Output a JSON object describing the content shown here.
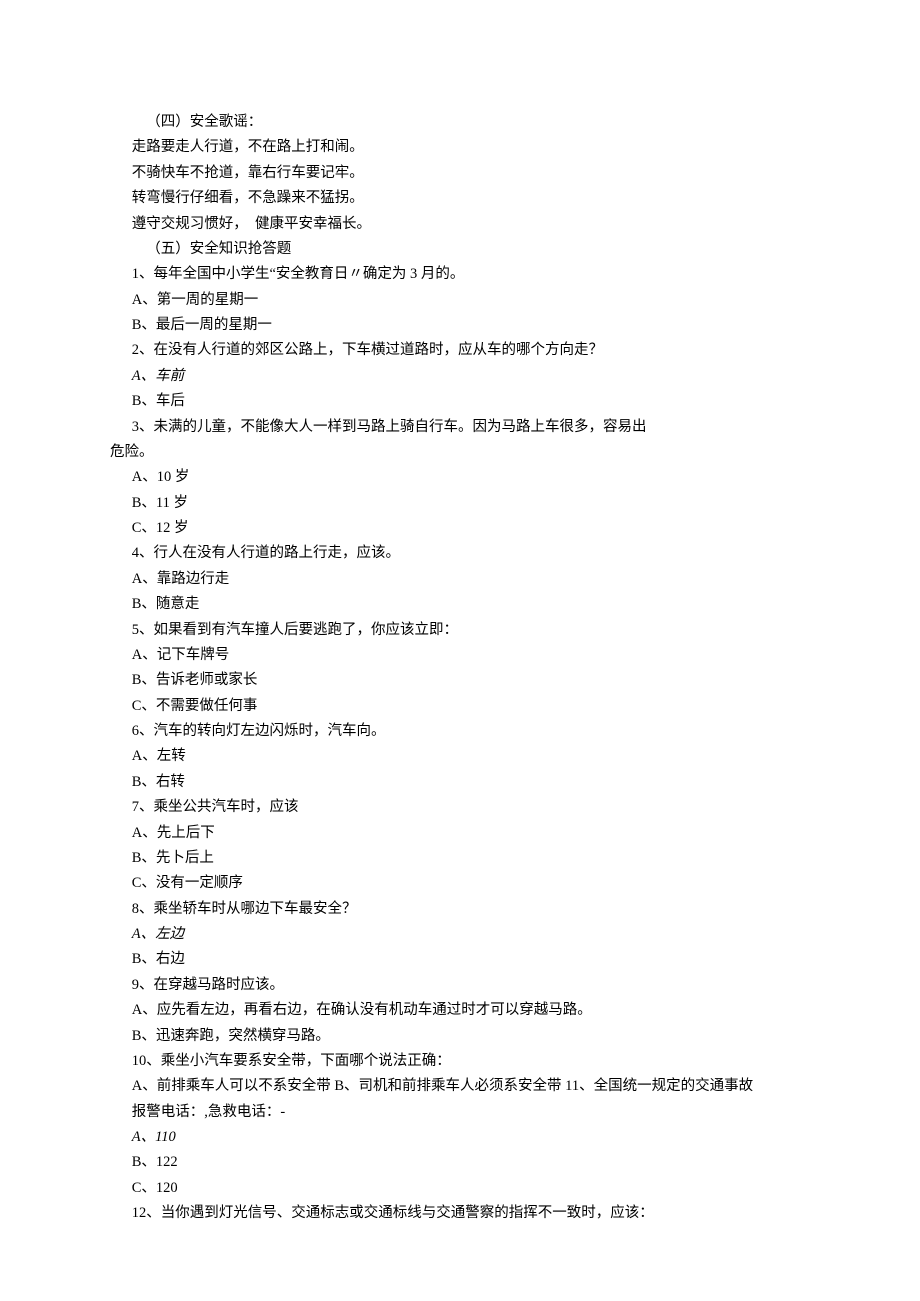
{
  "lines": [
    {
      "cls": "indent2",
      "text": "（四）安全歌谣："
    },
    {
      "cls": "indent1",
      "text": "走路要走人行道，不在路上打和闹。"
    },
    {
      "cls": "indent1",
      "text": "不骑快车不抢道，靠右行车要记牢。"
    },
    {
      "cls": "indent1",
      "text": "转弯慢行仔细看，不急躁来不猛拐。"
    },
    {
      "cls": "indent1",
      "text": "遵守交规习惯好，  健康平安幸福长。"
    },
    {
      "cls": "indent2",
      "text": "（五）安全知识抢答题"
    },
    {
      "cls": "indent1",
      "text": "1、每年全国中小学生“安全教育日〃确定为 3 月的。"
    },
    {
      "cls": "indent1",
      "text": "A、第一周的星期一"
    },
    {
      "cls": "indent1",
      "text": "B、最后一周的星期一"
    },
    {
      "cls": "indent1",
      "text": "2、在没有人行道的郊区公路上，下车横过道路时，应从车的哪个方向走？"
    },
    {
      "cls": "indent1 italic",
      "text": "A、车前"
    },
    {
      "cls": "indent1",
      "text": "B、车后"
    },
    {
      "cls": "indent1",
      "text": "3、未满的儿童，不能像大人一样到马路上骑自行车。因为马路上车很多，容易出"
    },
    {
      "cls": "noindent",
      "text": "危险。"
    },
    {
      "cls": "indent1",
      "text": "A、10 岁"
    },
    {
      "cls": "indent1",
      "text": "B、11 岁"
    },
    {
      "cls": "indent1",
      "text": "C、12 岁"
    },
    {
      "cls": "indent1",
      "text": "4、行人在没有人行道的路上行走，应该。"
    },
    {
      "cls": "indent1",
      "text": "A、靠路边行走"
    },
    {
      "cls": "indent1",
      "text": "B、随意走"
    },
    {
      "cls": "indent1",
      "text": "5、如果看到有汽车撞人后要逃跑了，你应该立即："
    },
    {
      "cls": "indent1",
      "text": "A、记下车牌号"
    },
    {
      "cls": "indent1",
      "text": "B、告诉老师或家长"
    },
    {
      "cls": "indent1",
      "text": "C、不需要做任何事"
    },
    {
      "cls": "indent1",
      "text": "6、汽车的转向灯左边闪烁时，汽车向。"
    },
    {
      "cls": "indent1",
      "text": "A、左转"
    },
    {
      "cls": "indent1",
      "text": "B、右转"
    },
    {
      "cls": "indent1",
      "text": "7、乘坐公共汽车时，应该"
    },
    {
      "cls": "indent1",
      "text": "A、先上后下"
    },
    {
      "cls": "indent1",
      "text": "B、先卜后上"
    },
    {
      "cls": "indent1",
      "text": "C、没有一定顺序"
    },
    {
      "cls": "indent1",
      "text": "8、乘坐轿车时从哪边下车最安全？"
    },
    {
      "cls": "indent1 italic",
      "text": "A、左边"
    },
    {
      "cls": "indent1",
      "text": "B、右边"
    },
    {
      "cls": "indent1",
      "text": "9、在穿越马路时应该。"
    },
    {
      "cls": "indent1",
      "text": "A、应先看左边，再看右边，在确认没有机动车通过时才可以穿越马路。"
    },
    {
      "cls": "indent1",
      "text": "B、迅速奔跑，突然横穿马路。"
    },
    {
      "cls": "indent1",
      "text": "10、乘坐小汽车要系安全带，下面哪个说法正确："
    },
    {
      "cls": "indent1",
      "text": "A、前排乘车人可以不系安全带 B、司机和前排乘车人必须系安全带 11、全国统一规定的交通事故"
    },
    {
      "cls": "indent1",
      "text": "报警电话：,急救电话：-"
    },
    {
      "cls": "indent1 italic",
      "text": "A、110"
    },
    {
      "cls": "indent1",
      "text": "B、122"
    },
    {
      "cls": "indent1",
      "text": "C、120"
    },
    {
      "cls": "indent1",
      "text": "12、当你遇到灯光信号、交通标志或交通标线与交通警察的指挥不一致时，应该："
    }
  ]
}
